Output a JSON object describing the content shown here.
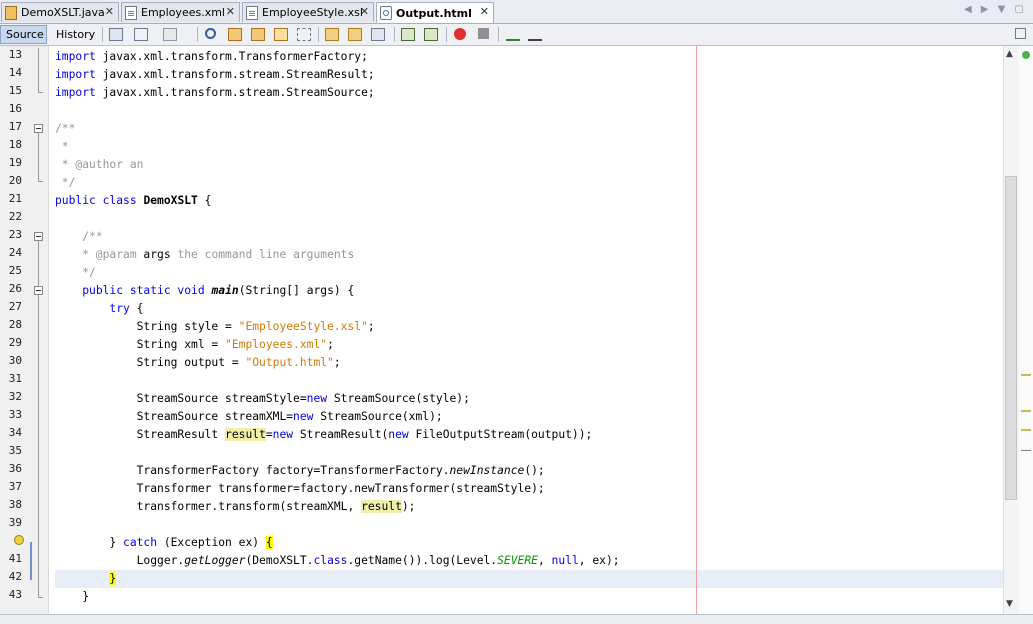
{
  "tabs": [
    {
      "label": "DemoXSLT.java",
      "icon": "java-file-icon"
    },
    {
      "label": "Employees.xml",
      "icon": "xml-file-icon"
    },
    {
      "label": "EmployeeStyle.xsl",
      "icon": "xsl-file-icon"
    },
    {
      "label": "Output.html",
      "icon": "html-file-icon"
    }
  ],
  "tab_close_glyph": "✕",
  "toolbar": {
    "source_label": "Source",
    "history_label": "History"
  },
  "line_numbers": [
    "13",
    "14",
    "15",
    "16",
    "17",
    "18",
    "19",
    "20",
    "21",
    "22",
    "23",
    "24",
    "25",
    "26",
    "27",
    "28",
    "29",
    "30",
    "31",
    "32",
    "33",
    "34",
    "35",
    "36",
    "37",
    "38",
    "39",
    "40",
    "41",
    "42",
    "43"
  ],
  "code": {
    "l13": [
      "import",
      " javax.xml.transform.TransformerFactory;"
    ],
    "l14": [
      "import",
      " javax.xml.transform.stream.StreamResult;"
    ],
    "l15": [
      "import",
      " javax.xml.transform.stream.StreamSource;"
    ],
    "l17": "/**",
    "l18": " *",
    "l19": " * @author an",
    "l20": " */",
    "l21": [
      "public class",
      " ",
      "DemoXSLT",
      " {"
    ],
    "l23": "    /**",
    "l24": [
      "    * @param ",
      "args",
      " the command line arguments"
    ],
    "l25": "    */",
    "l26": [
      "    ",
      "public static void",
      " ",
      "main",
      "(String[] args) {"
    ],
    "l27": [
      "        ",
      "try",
      " {"
    ],
    "l28": [
      "            String style = ",
      "\"EmployeeStyle.xsl\"",
      ";"
    ],
    "l29": [
      "            String xml = ",
      "\"Employees.xml\"",
      ";"
    ],
    "l30": [
      "            String output = ",
      "\"Output.html\"",
      ";"
    ],
    "l32": [
      "            StreamSource streamStyle=",
      "new",
      " StreamSource(style);"
    ],
    "l33": [
      "            StreamSource streamXML=",
      "new",
      " StreamSource(xml);"
    ],
    "l34": [
      "            StreamResult ",
      "result",
      "=",
      "new",
      " StreamResult(",
      "new",
      " FileOutputStream(output));"
    ],
    "l36": [
      "            TransformerFactory factory=TransformerFactory.",
      "newInstance",
      "();"
    ],
    "l37": "            Transformer transformer=factory.newTransformer(streamStyle);",
    "l38": [
      "            transformer.transform(streamXML, ",
      "result",
      ");"
    ],
    "l40": [
      "        } ",
      "catch",
      " (Exception ex) ",
      "{"
    ],
    "l41": [
      "            Logger.",
      "getLogger",
      "(DemoXSLT.",
      "class",
      ".getName()).log(Level.",
      "SEVERE",
      ", ",
      "null",
      ", ex);"
    ],
    "l42": [
      "        ",
      "}"
    ],
    "l43": "    }"
  },
  "colors": {
    "keyword": "#0000e6",
    "string": "#ce7b00",
    "comment": "#969696",
    "highlight": "#f2f0a8",
    "brace_match": "#ffff00",
    "current_line": "#e8eef8"
  }
}
